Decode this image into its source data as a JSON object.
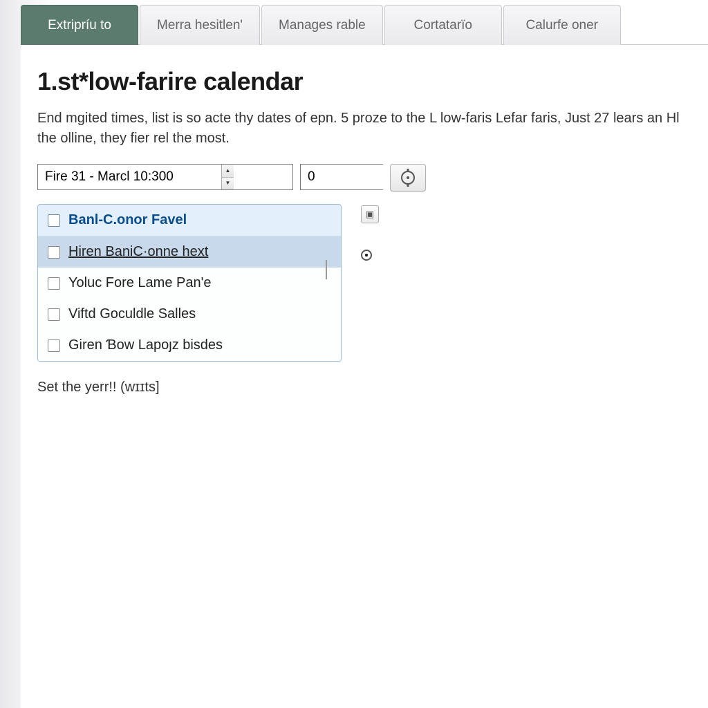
{
  "tabs": [
    {
      "label": "Extripríu to",
      "active": true
    },
    {
      "label": "Merra hesitlen'"
    },
    {
      "label": "Manages rable"
    },
    {
      "label": "Cortatarïo"
    },
    {
      "label": "Calurfe oner"
    }
  ],
  "heading": "1.st*low-farire calendar",
  "intro": "End mgited times, list is so acte thy dates of epn. 5 proze to the L low-faris Lefar faris, Just 27 lears an Hl the olline, they fier rel the most.",
  "date_input": {
    "value": "Fire 31 - Marcl 10:300"
  },
  "number_input": {
    "value": "0"
  },
  "list": {
    "header": "Banl-C.onor Favel",
    "items": [
      {
        "label": "Hiren BaniC·onne hext",
        "selected": true
      },
      {
        "label": "Yoluc Fore Lame Pan'e"
      },
      {
        "label": "Viftd Goculdle Salles"
      },
      {
        "label": "Giren Ɓow Lapoȷz bisdes"
      }
    ]
  },
  "footer": "Set the yerr!! (wɪɪts]"
}
